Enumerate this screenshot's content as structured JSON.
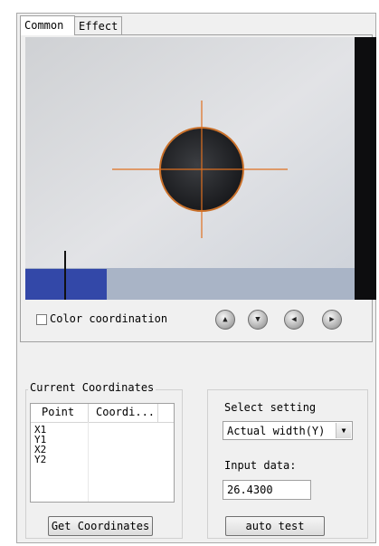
{
  "tabs": [
    {
      "label": "Common",
      "active": true
    },
    {
      "label": "Effect",
      "active": false
    }
  ],
  "camera": {
    "view_icon": "camera-preview",
    "crosshair_color": "#e07020"
  },
  "color_coordination": {
    "label": "Color coordination",
    "checked": false
  },
  "nav_buttons": [
    {
      "icon": "arrow-up-icon"
    },
    {
      "icon": "arrow-down-icon"
    },
    {
      "icon": "arrow-left-icon"
    },
    {
      "icon": "arrow-right-icon"
    }
  ],
  "current_coordinates": {
    "title": "Current Coordinates",
    "columns": [
      "Point",
      "Coordi..."
    ],
    "rows": [
      {
        "point": "X1",
        "value": ""
      },
      {
        "point": "Y1",
        "value": ""
      },
      {
        "point": "X2",
        "value": ""
      },
      {
        "point": "Y2",
        "value": ""
      }
    ],
    "button_label": "Get Coordinates"
  },
  "settings": {
    "select_label": "Select setting",
    "select_value": "Actual width(Y)",
    "input_label": "Input data:",
    "input_value": "26.4300",
    "button_label": "auto test"
  }
}
